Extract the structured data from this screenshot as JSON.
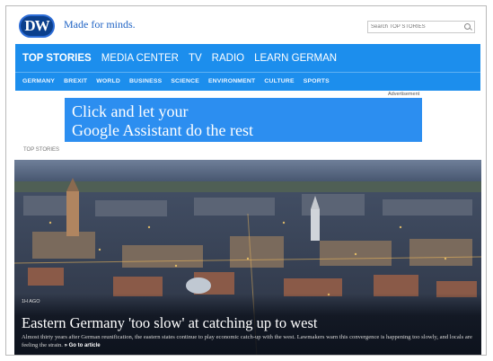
{
  "header": {
    "logo_text": "DW",
    "tagline": "Made for minds.",
    "search_placeholder": "Search TOP STORIES"
  },
  "nav": {
    "main": [
      "TOP STORIES",
      "MEDIA CENTER",
      "TV",
      "RADIO",
      "LEARN GERMAN"
    ],
    "active": "TOP STORIES",
    "sub": [
      "GERMANY",
      "BREXIT",
      "WORLD",
      "BUSINESS",
      "SCIENCE",
      "ENVIRONMENT",
      "CULTURE",
      "SPORTS"
    ]
  },
  "ad": {
    "label": "Advertisement",
    "line1": "Click and let your",
    "line2": "Google Assistant do the rest"
  },
  "section_label": "TOP STORIES",
  "hero": {
    "time": "1H AGO",
    "title": "Eastern Germany 'too slow' at catching up to west",
    "text": "Almost thirty years after German reunification, the eastern states continue to play economic catch-up with the west. Lawmakers warn this convergence is happening too slowly, and locals are feeling the strain.",
    "more": "Go to article"
  },
  "colors": {
    "brand": "#0b3f8c",
    "nav": "#1c8eed",
    "ad": "#2c8ef0"
  }
}
